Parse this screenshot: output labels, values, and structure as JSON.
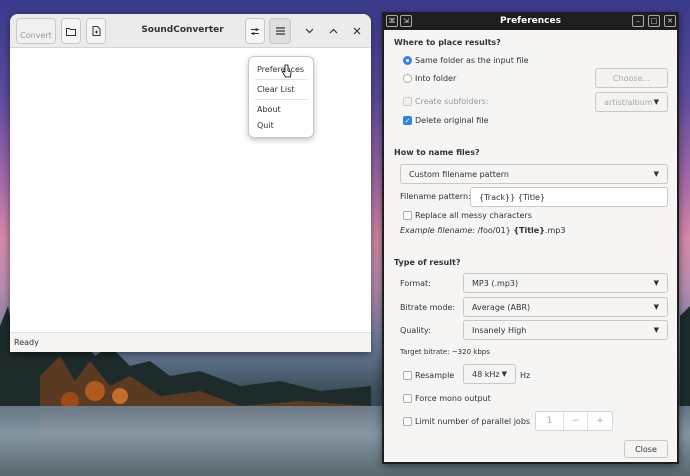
{
  "main_window": {
    "title": "SoundConverter",
    "convert_label": "Convert",
    "status_text": "Ready"
  },
  "menu": {
    "items": [
      "Preferences",
      "Clear List",
      "About",
      "Quit"
    ]
  },
  "preferences": {
    "title": "Preferences",
    "where_section": "Where to place results?",
    "same_folder": "Same folder as the input file",
    "into_folder": "Into folder",
    "choose_button": "Choose...",
    "create_subfolders": "Create subfolders:",
    "subfolder_pattern": "artist/album",
    "delete_original": "Delete original file",
    "name_section": "How to name files?",
    "naming_mode": "Custom filename pattern",
    "pattern_label": "Filename pattern:",
    "pattern_value": "{Track}} {Title}",
    "replace_messy": "Replace all messy characters",
    "example_label": "Example filename:",
    "example_path": "/foo/01}",
    "example_title": "{Title}",
    "example_ext": ".mp3",
    "type_section": "Type of result?",
    "format_label": "Format:",
    "format_value": "MP3 (.mp3)",
    "bitrate_mode_label": "Bitrate mode:",
    "bitrate_mode_value": "Average (ABR)",
    "quality_label": "Quality:",
    "quality_value": "Insanely High",
    "target_bitrate": "Target bitrate: ~320 kbps",
    "resample_label": "Resample",
    "resample_rate": "48 kHz",
    "hz_label": "Hz",
    "force_mono": "Force mono output",
    "limit_jobs": "Limit number of parallel jobs",
    "jobs_value": "1",
    "close_button": "Close"
  }
}
